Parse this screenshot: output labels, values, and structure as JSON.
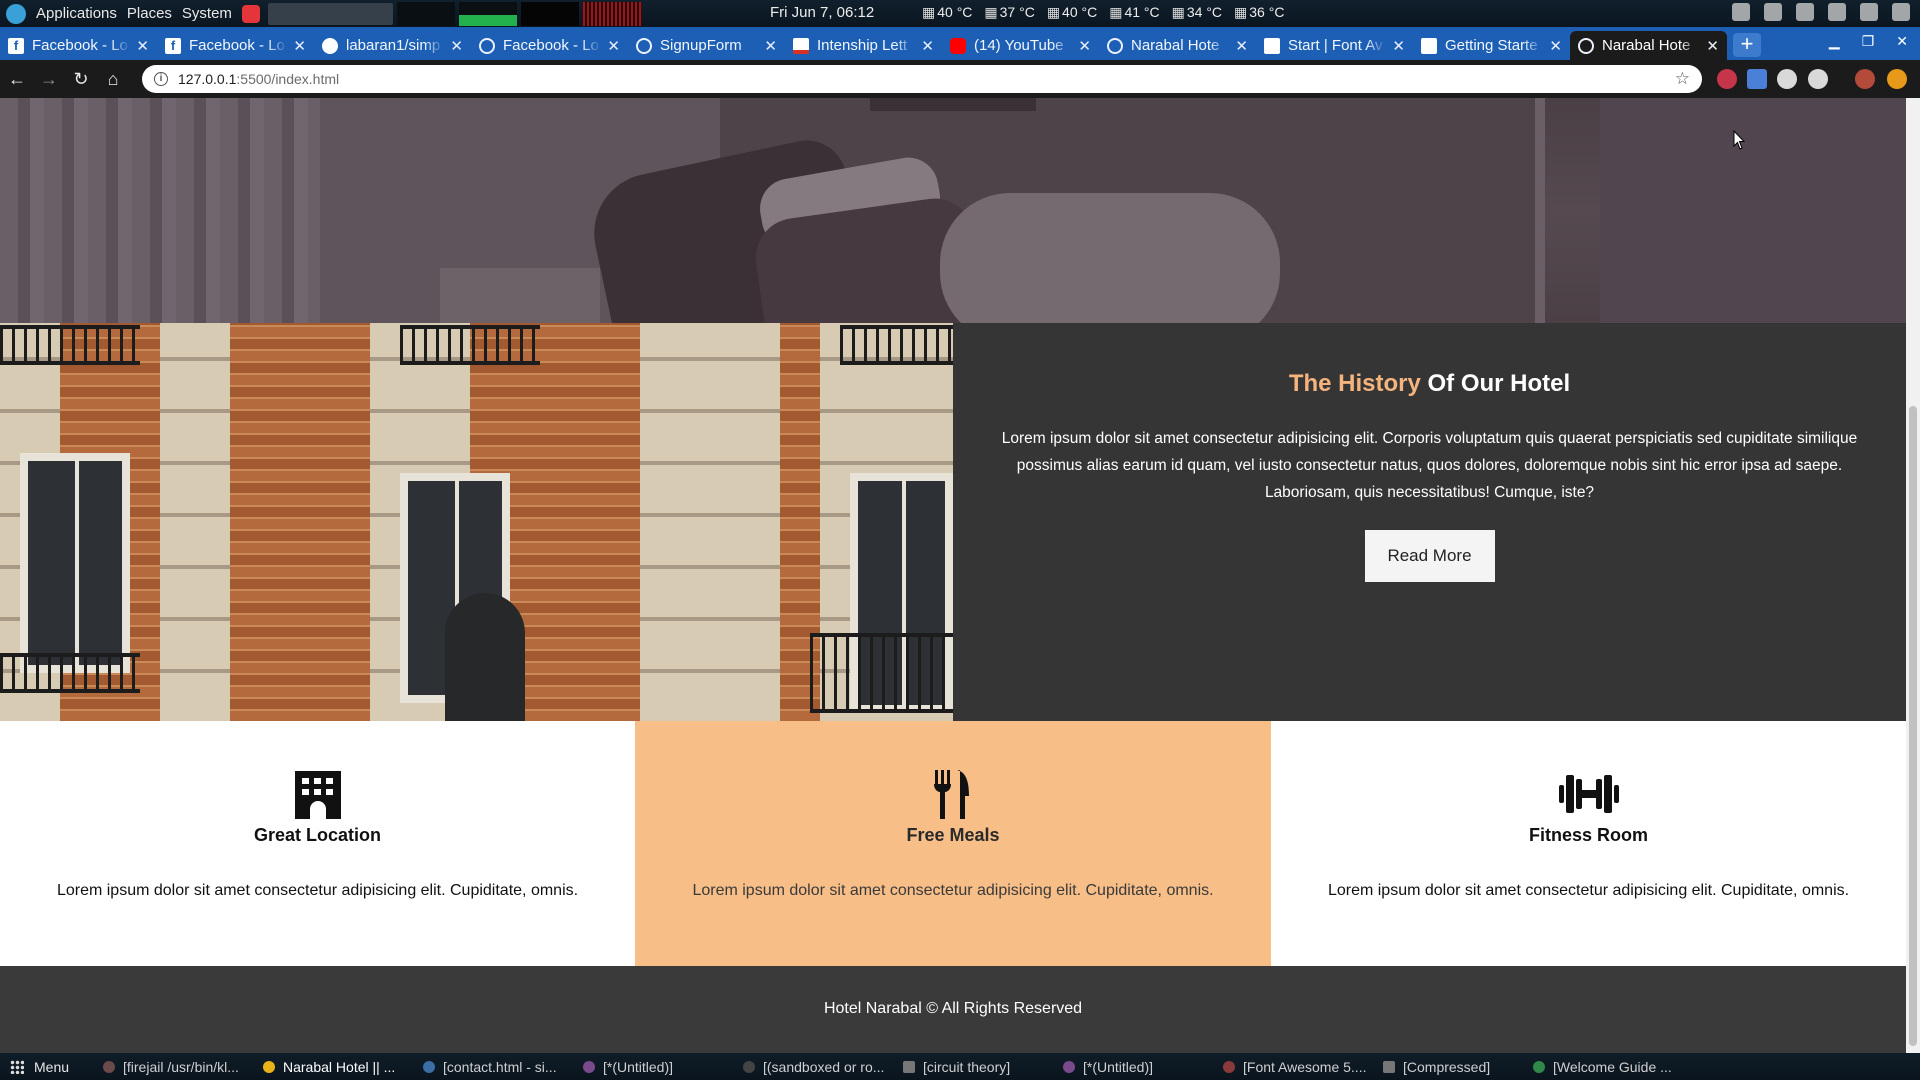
{
  "system_panel": {
    "menus": [
      "Applications",
      "Places",
      "System"
    ],
    "clock": "Fri Jun 7, 06:12",
    "temps": [
      "40 °C",
      "37 °C",
      "40 °C",
      "41 °C",
      "34 °C",
      "36 °C"
    ]
  },
  "browser": {
    "tabs": [
      {
        "label": "Facebook - Lo",
        "icon": "facebook-icon"
      },
      {
        "label": "Facebook - Lo",
        "icon": "facebook-icon"
      },
      {
        "label": "labaran1/simp",
        "icon": "github-icon"
      },
      {
        "label": "Facebook - Lo",
        "icon": "globe-icon"
      },
      {
        "label": "SignupForm",
        "icon": "globe-icon"
      },
      {
        "label": "Intenship Lett",
        "icon": "gmail-icon"
      },
      {
        "label": "(14) YouTube",
        "icon": "youtube-icon"
      },
      {
        "label": "Narabal Hote",
        "icon": "globe-icon"
      },
      {
        "label": "Start | Font Av",
        "icon": "flag-icon"
      },
      {
        "label": "Getting Starte",
        "icon": "flag-icon"
      },
      {
        "label": "Narabal Hote",
        "icon": "globe-icon",
        "active": true
      }
    ],
    "url_host": "127.0.0.1",
    "url_path": ":5500/index.html"
  },
  "history": {
    "title_accent": "The History",
    "title_rest": " Of Our Hotel",
    "body": "Lorem ipsum dolor sit amet consectetur adipisicing elit. Corporis voluptatum quis quaerat perspiciatis sed cupiditate similique possimus alias earum id quam, vel iusto consectetur natus, quos dolores, doloremque nobis sint hic error ipsa ad saepe. Laboriosam, quis necessitatibus! Cumque, iste?",
    "button": "Read More",
    "accent_color": "#f5b37d"
  },
  "features": [
    {
      "title": "Great Location",
      "text": "Lorem ipsum dolor sit amet consectetur adipisicing elit. Cupiditate, omnis.",
      "icon": "building-icon"
    },
    {
      "title": "Free Meals",
      "text": "Lorem ipsum dolor sit amet consectetur adipisicing elit. Cupiditate, omnis.",
      "icon": "utensils-icon"
    },
    {
      "title": "Fitness Room",
      "text": "Lorem ipsum dolor sit amet consectetur adipisicing elit. Cupiditate, omnis.",
      "icon": "dumbbell-icon"
    }
  ],
  "footer": {
    "text": "Hotel Narabal © All Rights Reserved"
  },
  "colors": {
    "feature_highlight": "#f7be88",
    "history_bg": "#353535",
    "footer_bg": "#3a3a3a"
  },
  "taskbar": {
    "menu_label": "Menu",
    "tasks": [
      "[firejail /usr/bin/kl...",
      "Narabal Hotel || ...",
      "[contact.html - si...",
      "[*(Untitled)]",
      "[(sandboxed or ro...",
      "[circuit theory]",
      "[*(Untitled)]",
      "[Font Awesome 5....",
      "[Compressed]",
      "[Welcome Guide ..."
    ]
  }
}
